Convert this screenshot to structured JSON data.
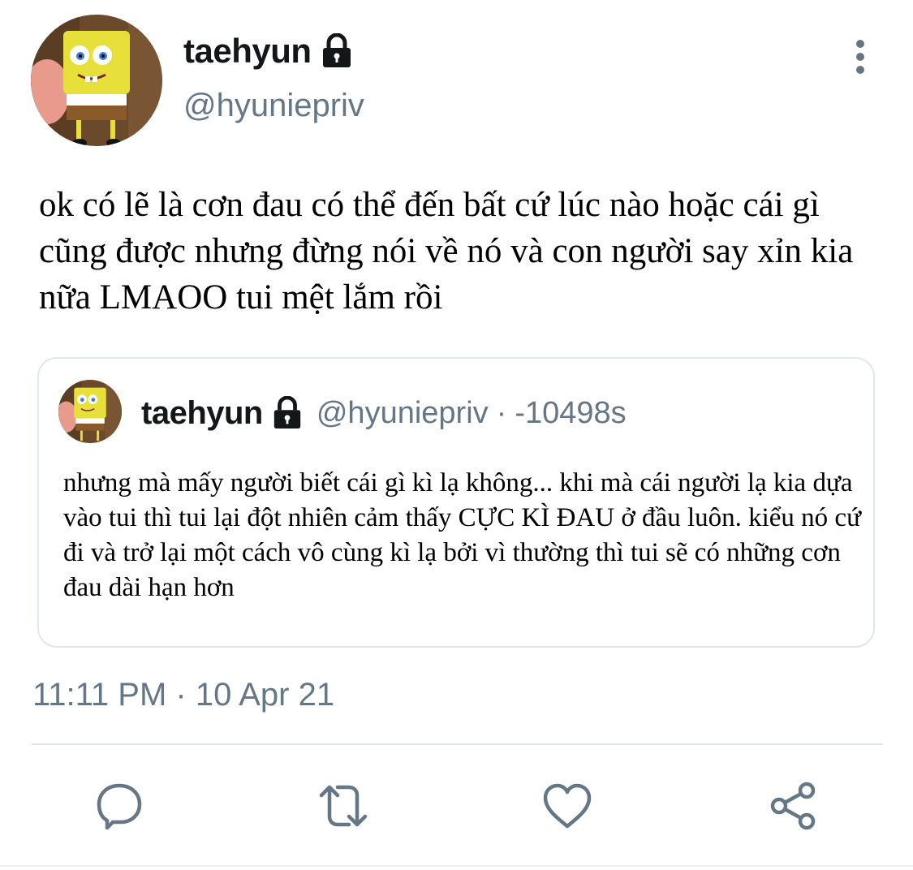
{
  "tweet": {
    "author": {
      "display_name": "taehyun",
      "handle": "@hyuniepriv",
      "avatar_icon": "spongebob-avatar",
      "lock_icon": "lock-icon"
    },
    "text": "ok có lẽ là cơn đau có thể đến bất cứ lúc nào hoặc cái gì cũng được nhưng đừng nói về nó và con người say xỉn kia nữa LMAOO tui mệt lắm rồi",
    "timestamp": "11:11 PM · 10 Apr 21",
    "more_icon": "more-vertical-icon"
  },
  "quoted_tweet": {
    "display_name": "taehyun",
    "handle": "@hyuniepriv",
    "separator": "·",
    "time": "-10498s",
    "text": "nhưng mà mấy người biết cái gì kì lạ không... khi mà cái người lạ kia dựa vào tui thì tui lại đột nhiên cảm thấy  CỰC KÌ ĐAU ở đầu luôn. kiểu nó cứ đi và trở lại một cách vô cùng kì lạ bởi vì thường thì tui sẽ có những cơn đau dài hạn hơn"
  },
  "actions": [
    {
      "name": "reply",
      "icon": "reply-icon"
    },
    {
      "name": "retweet",
      "icon": "retweet-icon"
    },
    {
      "name": "like",
      "icon": "heart-icon"
    },
    {
      "name": "share",
      "icon": "share-icon"
    }
  ],
  "colors": {
    "text": "#0f1419",
    "secondary": "#657786",
    "border": "#e1e8ed",
    "icon": "#657786"
  }
}
